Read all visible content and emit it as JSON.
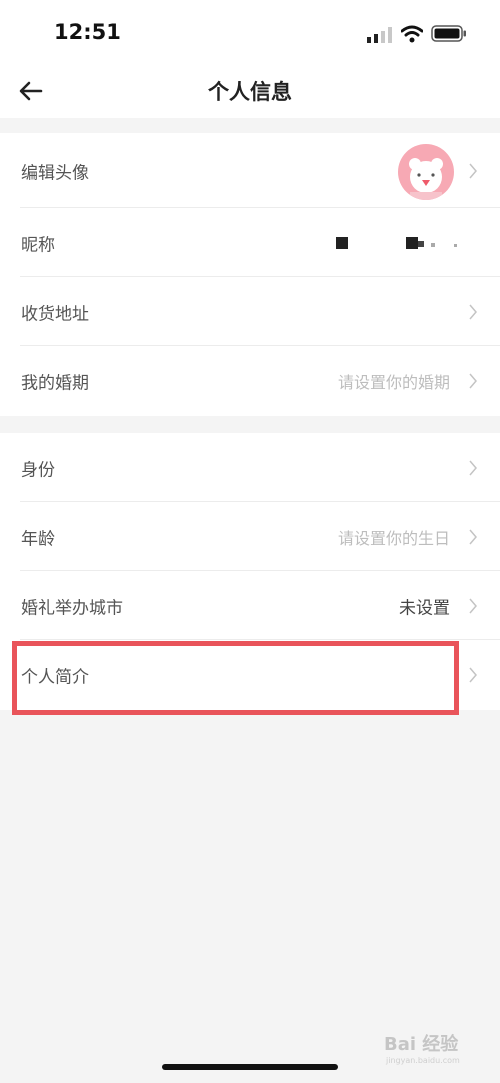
{
  "status": {
    "time": "12:51"
  },
  "header": {
    "title": "个人信息"
  },
  "group1": [
    {
      "label": "编辑头像"
    },
    {
      "label": "昵称"
    },
    {
      "label": "收货地址"
    },
    {
      "label": "我的婚期",
      "value": "请设置你的婚期"
    }
  ],
  "group2": [
    {
      "label": "身份"
    },
    {
      "label": "年龄",
      "value": "请设置你的生日"
    },
    {
      "label": "婚礼举办城市",
      "value": "未设置"
    },
    {
      "label": "个人简介"
    }
  ],
  "watermark": {
    "text": "Bai 经验",
    "sub": "jingyan.baidu.com"
  },
  "colors": {
    "highlight": "#e9545a",
    "background": "#f4f4f4",
    "placeholder": "#bdbdbd"
  }
}
